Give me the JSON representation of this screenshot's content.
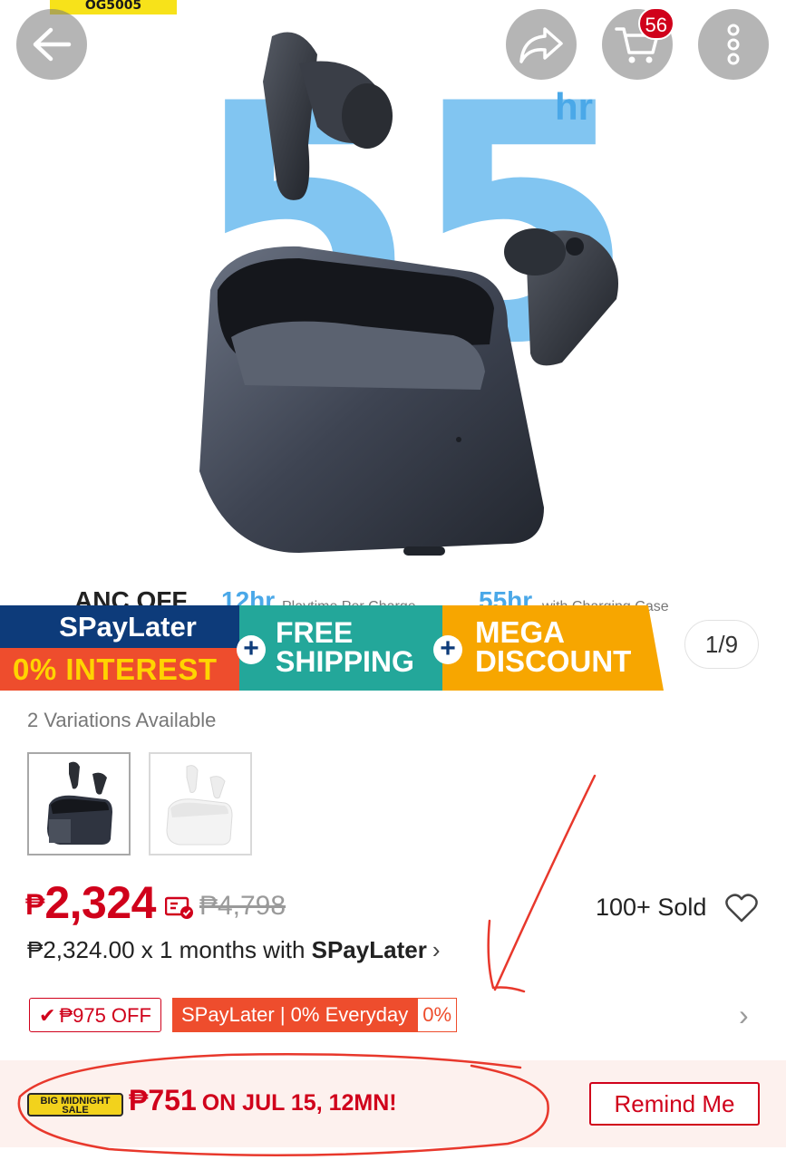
{
  "hero": {
    "brand_badge": "OG5005",
    "big_number": "55",
    "big_number_unit": "hr",
    "caption_anc": "ANC OFF",
    "caption_12hr": "12hr",
    "caption_playtime": "Playtime Per Charge",
    "caption_55hr": "55hr",
    "caption_case": "with Charging Case"
  },
  "top_nav": {
    "cart_count": "56"
  },
  "promo_banner": {
    "spaylater": "SPayLater",
    "interest": "0% INTEREST",
    "free_line1": "FREE",
    "free_line2": "SHIPPING",
    "mega_line1": "MEGA",
    "mega_line2": "DISCOUNT",
    "plus": "+"
  },
  "gallery": {
    "page_indicator": "1/9"
  },
  "variations": {
    "label": "2 Variations Available",
    "items": [
      {
        "color": "#2f3440"
      },
      {
        "color": "#f3f3f3"
      }
    ]
  },
  "price": {
    "currency": "₱",
    "current": "2,324",
    "original": "₱4,798",
    "sold": "100+ Sold",
    "installment_amount": "₱2,324.00 x 1 months with ",
    "installment_brand": "SPayLater",
    "installment_chevron": "›"
  },
  "tags": {
    "off_check": "✔",
    "off_label": "₱975 OFF",
    "spaylater_label": "SPayLater | 0% Everyday",
    "spaylater_pct": "0%",
    "chevron": "›"
  },
  "flash_sale": {
    "logo_line1": "BIG MIDNIGHT",
    "logo_line2": "SALE",
    "price": "₱751",
    "rest": "ON JUL 15, 12MN!",
    "remind_button": "Remind Me"
  },
  "colors": {
    "shopee_red": "#d0011b",
    "shopee_orange": "#ee4d2d",
    "navy": "#0d3b7a",
    "teal": "#23a79a",
    "amber": "#f7a600",
    "hero_blue": "#4aa8e8",
    "annotation_red": "#e8382c"
  }
}
